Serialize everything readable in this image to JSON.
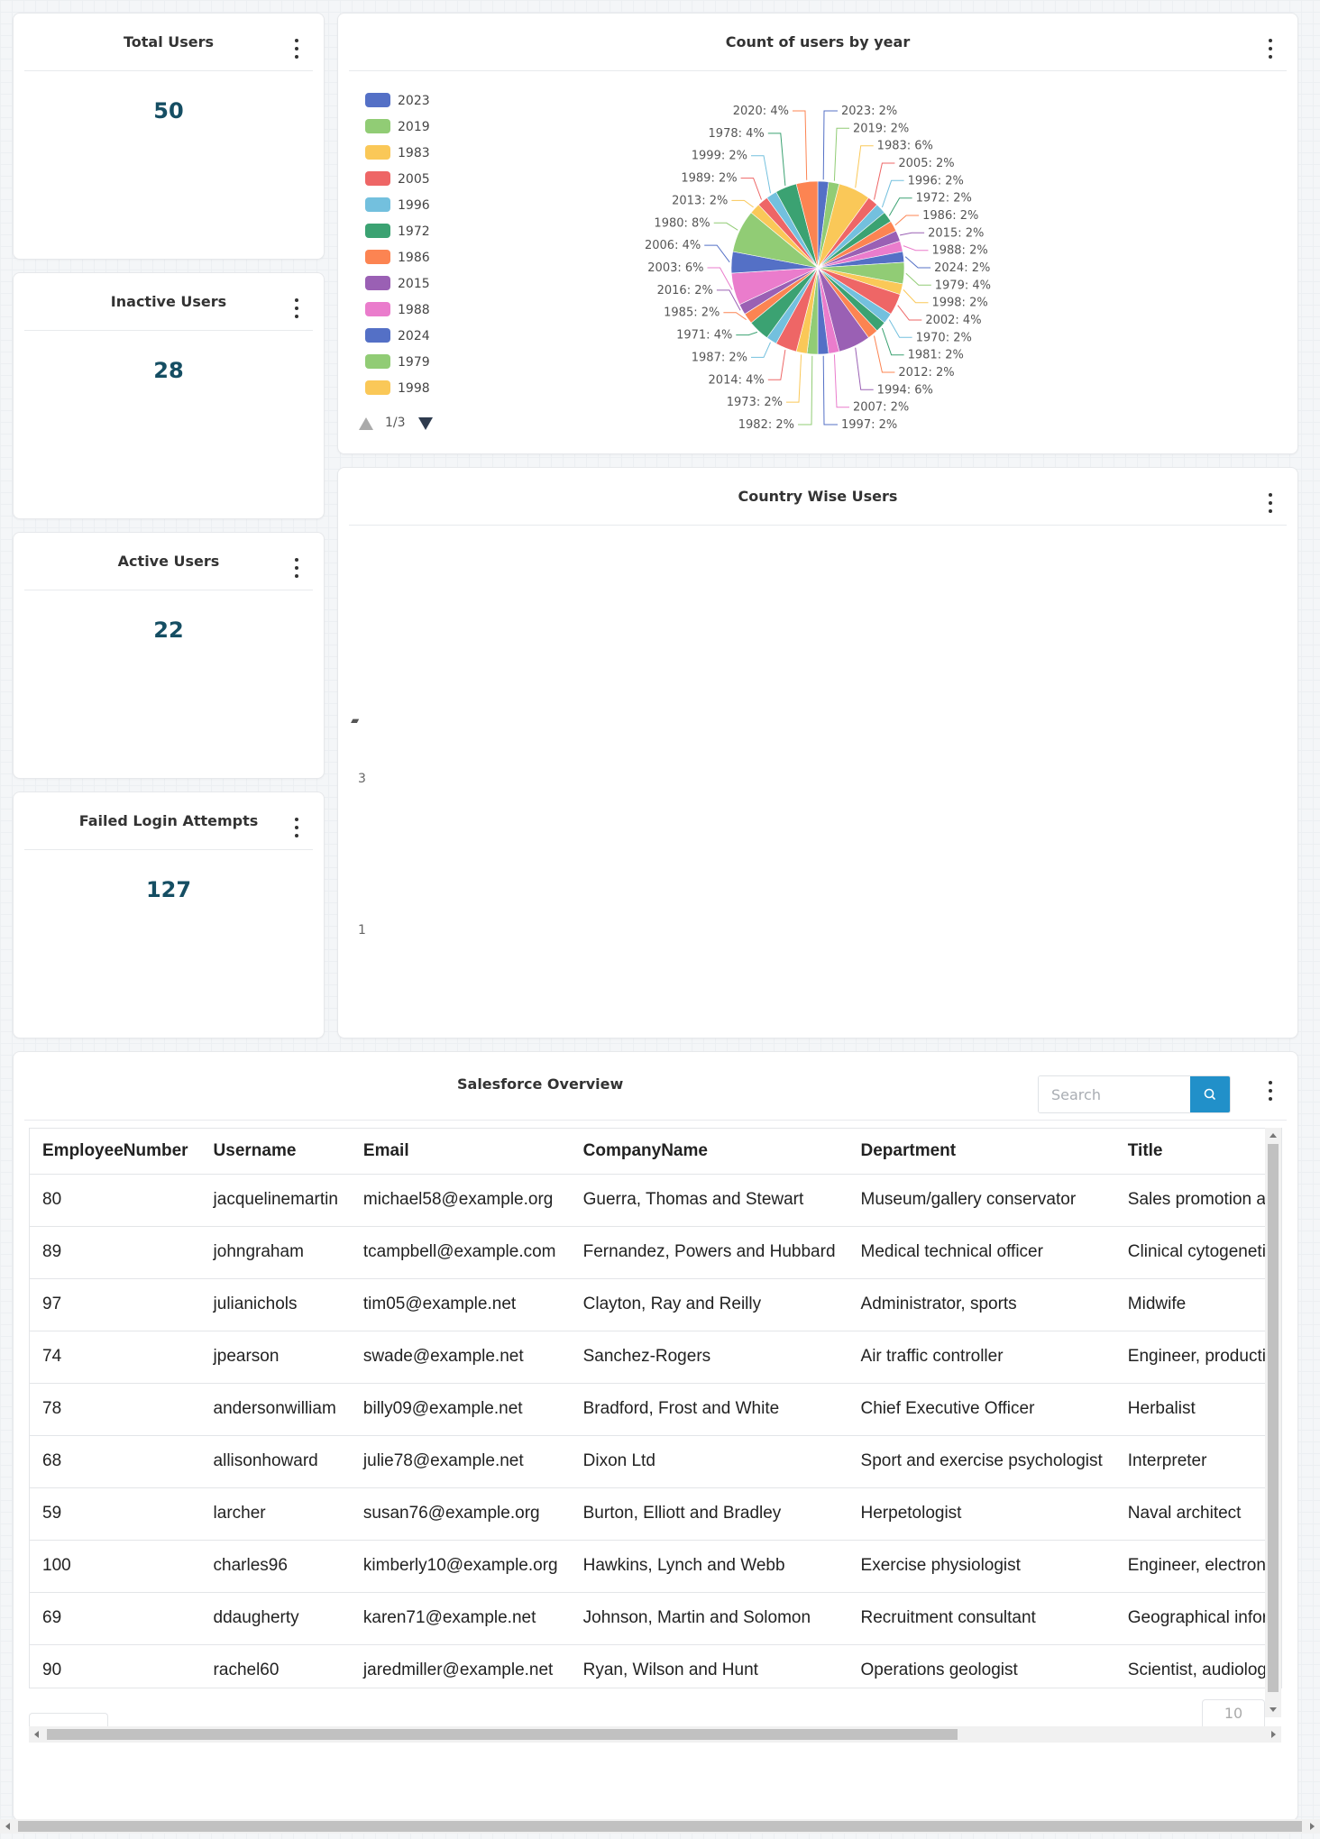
{
  "stats": {
    "total_users": {
      "title": "Total Users",
      "value": "50"
    },
    "inactive_users": {
      "title": "Inactive Users",
      "value": "28"
    },
    "active_users": {
      "title": "Active Users",
      "value": "22"
    },
    "failed_logins": {
      "title": "Failed Login Attempts",
      "value": "127"
    }
  },
  "pie_card": {
    "title": "Count of users by year",
    "pager_text": "1/3"
  },
  "country_card": {
    "title": "Country Wise Users",
    "ticks": [
      "3",
      "1"
    ]
  },
  "table_card": {
    "title": "Salesforce Overview",
    "search_placeholder": "Search",
    "page_size": "10",
    "columns": [
      "EmployeeNumber",
      "Username",
      "Email",
      "CompanyName",
      "Department",
      "Title"
    ],
    "rows": [
      [
        "80",
        "jacquelinemartin",
        "michael58@example.org",
        "Guerra, Thomas and Stewart",
        "Museum/gallery conservator",
        "Sales promotion account executive"
      ],
      [
        "89",
        "johngraham",
        "tcampbell@example.com",
        "Fernandez, Powers and Hubbard",
        "Medical technical officer",
        "Clinical cytogeneticist"
      ],
      [
        "97",
        "julianichols",
        "tim05@example.net",
        "Clayton, Ray and Reilly",
        "Administrator, sports",
        "Midwife"
      ],
      [
        "74",
        "jpearson",
        "swade@example.net",
        "Sanchez-Rogers",
        "Air traffic controller",
        "Engineer, production"
      ],
      [
        "78",
        "andersonwilliam",
        "billy09@example.net",
        "Bradford, Frost and White",
        "Chief Executive Officer",
        "Herbalist"
      ],
      [
        "68",
        "allisonhoward",
        "julie78@example.net",
        "Dixon Ltd",
        "Sport and exercise psychologist",
        "Interpreter"
      ],
      [
        "59",
        "larcher",
        "susan76@example.org",
        "Burton, Elliott and Bradley",
        "Herpetologist",
        "Naval architect"
      ],
      [
        "100",
        "charles96",
        "kimberly10@example.org",
        "Hawkins, Lynch and Webb",
        "Exercise physiologist",
        "Engineer, electronics"
      ],
      [
        "69",
        "ddaugherty",
        "karen71@example.net",
        "Johnson, Martin and Solomon",
        "Recruitment consultant",
        "Geographical information systems officer"
      ],
      [
        "90",
        "rachel60",
        "jaredmiller@example.net",
        "Ryan, Wilson and Hunt",
        "Operations geologist",
        "Scientist, audiological"
      ]
    ]
  },
  "chart_data": {
    "type": "pie",
    "title": "Count of users by year",
    "legend_position": "left",
    "legend_visible": [
      "2023",
      "2019",
      "1983",
      "2005",
      "1996",
      "1972",
      "1986",
      "2015",
      "1988",
      "2024",
      "1979",
      "1998"
    ],
    "palette": [
      "#5470c6",
      "#91cc75",
      "#fac858",
      "#ee6666",
      "#73c0de",
      "#3ba272",
      "#fc8452",
      "#9a60b4",
      "#ea7ccc"
    ],
    "slices": [
      {
        "label": "2023",
        "value": 2
      },
      {
        "label": "2019",
        "value": 2
      },
      {
        "label": "1983",
        "value": 6
      },
      {
        "label": "2005",
        "value": 2
      },
      {
        "label": "1996",
        "value": 2
      },
      {
        "label": "1972",
        "value": 2
      },
      {
        "label": "1986",
        "value": 2
      },
      {
        "label": "2015",
        "value": 2
      },
      {
        "label": "1988",
        "value": 2
      },
      {
        "label": "2024",
        "value": 2
      },
      {
        "label": "1979",
        "value": 4
      },
      {
        "label": "1998",
        "value": 2
      },
      {
        "label": "2002",
        "value": 4
      },
      {
        "label": "1970",
        "value": 2
      },
      {
        "label": "1981",
        "value": 2
      },
      {
        "label": "2012",
        "value": 2
      },
      {
        "label": "1994",
        "value": 6
      },
      {
        "label": "2007",
        "value": 2
      },
      {
        "label": "1997",
        "value": 2
      },
      {
        "label": "1982",
        "value": 2
      },
      {
        "label": "1973",
        "value": 2
      },
      {
        "label": "2014",
        "value": 4
      },
      {
        "label": "1987",
        "value": 2
      },
      {
        "label": "1971",
        "value": 4
      },
      {
        "label": "1985",
        "value": 2
      },
      {
        "label": "2016",
        "value": 2
      },
      {
        "label": "2003",
        "value": 6
      },
      {
        "label": "2006",
        "value": 4
      },
      {
        "label": "1980",
        "value": 8
      },
      {
        "label": "2013",
        "value": 2
      },
      {
        "label": "1989",
        "value": 2
      },
      {
        "label": "1999",
        "value": 2
      },
      {
        "label": "1978",
        "value": 4
      },
      {
        "label": "2020",
        "value": 4
      }
    ]
  }
}
